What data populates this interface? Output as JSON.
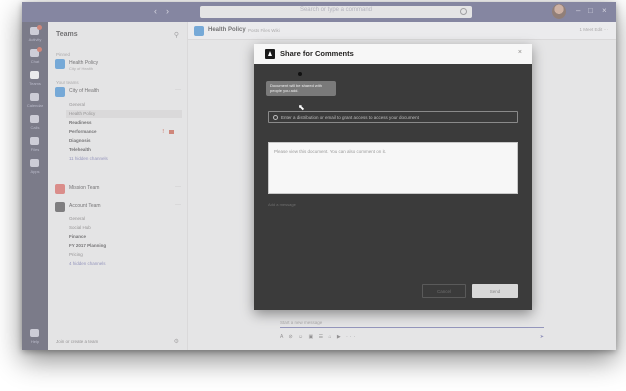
{
  "titlebar": {
    "back": "‹",
    "forward": "›",
    "search_placeholder": "Search or type a command",
    "win_min": "–",
    "win_max": "□",
    "win_close": "×"
  },
  "rail": {
    "items": [
      {
        "label": "Activity"
      },
      {
        "label": "Chat"
      },
      {
        "label": "Teams"
      },
      {
        "label": "Calendar"
      },
      {
        "label": "Calls"
      },
      {
        "label": "Files"
      },
      {
        "label": "Apps"
      },
      {
        "label": "Help"
      }
    ]
  },
  "pane": {
    "title": "Teams",
    "filter_icon": "filter-icon",
    "group_pinned": "Pinned",
    "group_yours": "Your teams",
    "pinned_team": {
      "name": "Health Policy",
      "sub": "City of Health"
    },
    "team1": {
      "name": "City of Health"
    },
    "team1_channels": [
      "General",
      "Health Policy",
      "Readiness",
      "Performance",
      "Diagnosis",
      "Telehealth",
      "11 hidden channels"
    ],
    "team2": {
      "name": "Mission Team"
    },
    "team3": {
      "name": "Account Team"
    },
    "team3_channels": [
      "General",
      "Social Hub",
      "Finance",
      "FY 2017 Planning",
      "Pricing",
      "4 hidden channels"
    ],
    "footer": "Join or create a team"
  },
  "main": {
    "title": "Health Policy",
    "tabs": "Posts   Files   Wiki",
    "right": "1 Meet   Edit   ···",
    "compose_placeholder": "Start a new message",
    "compose_tools": "A  ⊘  ☺  ▣  ☰  ⌂  ▶  ···",
    "send": "➤"
  },
  "modal": {
    "title": "Share for Comments",
    "close": "×",
    "tooltip_line1": "Document will be shared with",
    "tooltip_line2": "people you add.",
    "to_placeholder": "Enter a distribution or email to grant access to access your document",
    "message_placeholder": "Please view this document. You can also comment on it.",
    "add_link": "Add a message",
    "cancel_label": "Cancel",
    "send_label": "Send"
  }
}
